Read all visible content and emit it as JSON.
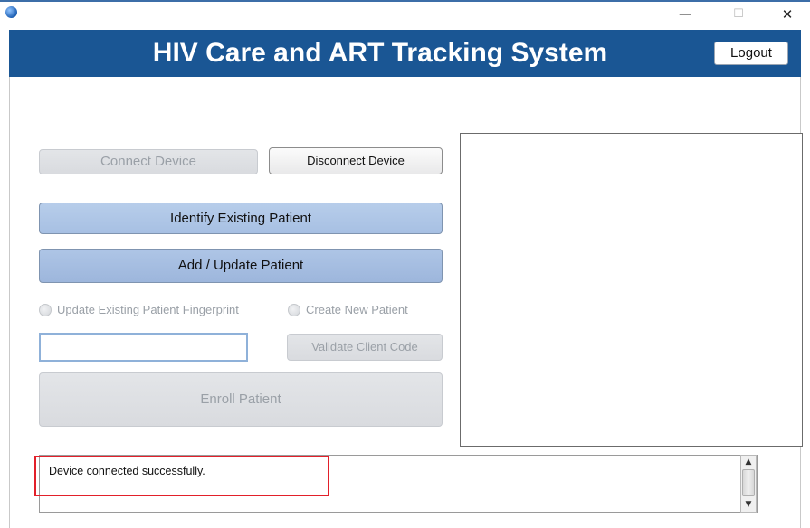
{
  "window": {
    "minimize_glyph": "—",
    "maximize_glyph": "☐",
    "close_glyph": "✕",
    "app_icon": "globe-icon"
  },
  "header": {
    "title": "HIV Care and ART Tracking System",
    "logout_label": "Logout",
    "background_color": "#1a5694"
  },
  "device": {
    "connect_label": "Connect Device",
    "disconnect_label": "Disconnect Device",
    "connect_enabled": false
  },
  "patient_actions": {
    "identify_label": "Identify Existing Patient",
    "add_update_label": "Add / Update Patient"
  },
  "options": {
    "update_fingerprint_label": "Update Existing Patient Fingerprint",
    "create_new_label": "Create New Patient"
  },
  "client_code": {
    "value": "",
    "validate_label": "Validate Client Code"
  },
  "enroll": {
    "label": "Enroll Patient"
  },
  "log": {
    "message": "Device connected successfully.",
    "highlight_color": "#e2202a"
  }
}
